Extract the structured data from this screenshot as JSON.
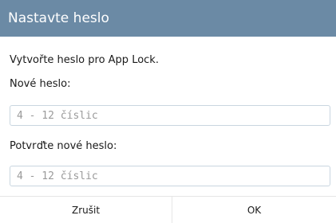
{
  "dialog": {
    "title": "Nastavte heslo",
    "message": "Vytvořte heslo pro App Lock.",
    "new_password": {
      "label": "Nové heslo:",
      "value": "",
      "placeholder": "4 - 12 číslic"
    },
    "confirm_password": {
      "label": "Potvrďte nové heslo:",
      "value": "",
      "placeholder": "4 - 12 číslic"
    },
    "buttons": {
      "cancel": "Zrušit",
      "ok": "OK"
    }
  },
  "colors": {
    "titlebar": "#6b8aa5",
    "field_border": "#c9d6e0"
  }
}
